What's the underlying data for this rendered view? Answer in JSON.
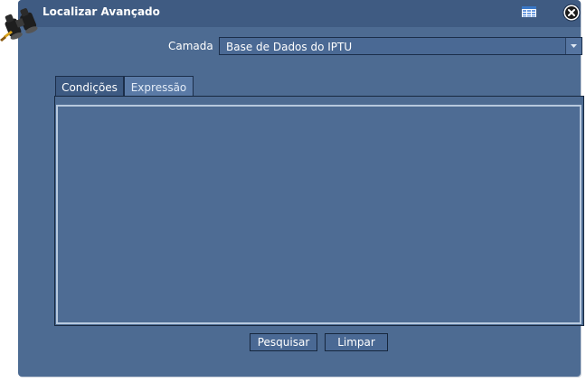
{
  "window": {
    "title": "Localizar Avançado",
    "icons": {
      "app": "binoculars-icon",
      "table": "table-icon",
      "minimize": "minimize-icon",
      "close": "close-icon"
    }
  },
  "form": {
    "layer_label": "Camada",
    "layer_value": "Base de Dados do IPTU"
  },
  "tabs": [
    {
      "label": "Condições"
    },
    {
      "label": "Expressão"
    }
  ],
  "expression_text": "",
  "buttons": {
    "search": "Pesquisar",
    "clear": "Limpar"
  },
  "colors": {
    "window_bg": "#4d6b92",
    "titlebar_bg": "#3f5b82",
    "textarea_border": "#b7c9de"
  }
}
